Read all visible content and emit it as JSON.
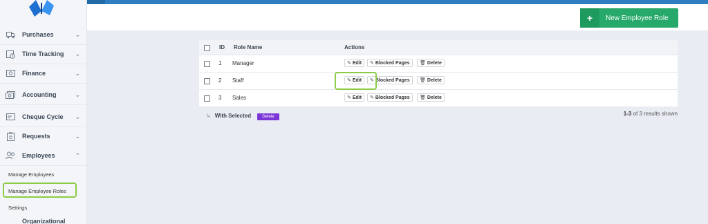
{
  "sidebar": {
    "items": [
      {
        "label": "Purchases",
        "icon": "truck-icon",
        "chev": "⌄"
      },
      {
        "label": "Time Tracking",
        "icon": "clock-icon",
        "chev": "⌄"
      },
      {
        "label": "Finance",
        "icon": "money-icon",
        "chev": "⌄"
      },
      {
        "label": "Accounting",
        "icon": "accounting-icon",
        "chev": "⌄"
      },
      {
        "label": "Cheque Cycle",
        "icon": "cheque-icon",
        "chev": "⌄"
      },
      {
        "label": "Requests",
        "icon": "clipboard-icon",
        "chev": "⌄"
      },
      {
        "label": "Employees",
        "icon": "users-icon",
        "chev": "⌃"
      }
    ],
    "sub_items": [
      "Manage Employees",
      "Manage Employee Roles",
      "Settings"
    ],
    "partial_label": "Organizational"
  },
  "toolbar": {
    "new_role_label": "New Employee Role",
    "plus": "+"
  },
  "table": {
    "headers": {
      "id": "ID",
      "role_name": "Role Name",
      "actions": "Actions"
    },
    "rows": [
      {
        "id": "1",
        "name": "Manager"
      },
      {
        "id": "2",
        "name": "Staff"
      },
      {
        "id": "3",
        "name": "Sales"
      }
    ],
    "action_labels": {
      "edit": "Edit",
      "blocked": "Blocked Pages",
      "delete": "Delete"
    }
  },
  "footer": {
    "with_selected": "With Selected",
    "delete_badge": "Delete",
    "results_range": "1-3",
    "results_text": " of 3 results shown"
  },
  "colors": {
    "accent": "#26a96a",
    "topbar": "#2f7ec2",
    "highlight": "#8ccc45",
    "delete_badge": "#7b36d6"
  }
}
